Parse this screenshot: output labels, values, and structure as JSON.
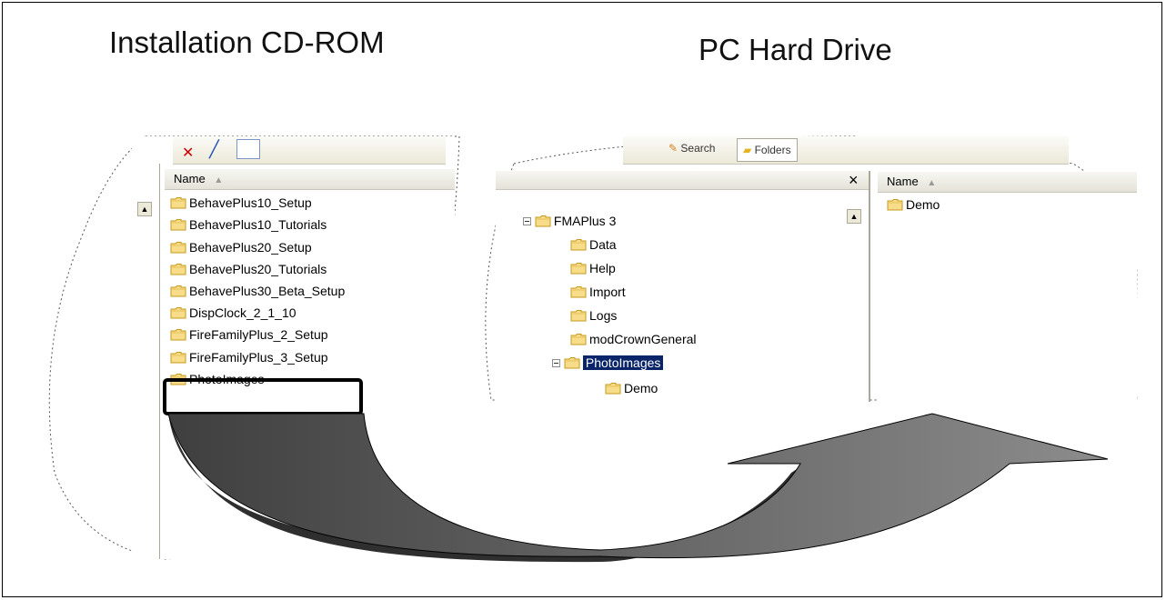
{
  "headings": {
    "left": "Installation CD-ROM",
    "right": "PC Hard Drive"
  },
  "cdrom": {
    "column_header": "Name",
    "folders": [
      "BehavePlus10_Setup",
      "BehavePlus10_Tutorials",
      "BehavePlus20_Setup",
      "BehavePlus20_Tutorials",
      "BehavePlus30_Beta_Setup",
      "DispClock_2_1_10",
      "FireFamilyPlus_2_Setup",
      "FireFamilyPlus_3_Setup",
      "PhotoImages"
    ],
    "highlighted": "PhotoImages"
  },
  "harddrive": {
    "toolbar": {
      "search_label": "Search",
      "folders_label": "Folders"
    },
    "close_glyph": "×",
    "tree": {
      "root": "FMAPlus 3",
      "children": [
        "Data",
        "Help",
        "Import",
        "Logs",
        "modCrownGeneral"
      ],
      "selected": "PhotoImages",
      "selected_child": "Demo"
    },
    "column_header": "Name",
    "right_items": [
      "Demo"
    ]
  },
  "colors": {
    "arrow_dark": "#4a4a4a",
    "arrow_light": "#8a8a8a",
    "selection": "#0a246a",
    "folder_fill": "#f5d57a"
  }
}
